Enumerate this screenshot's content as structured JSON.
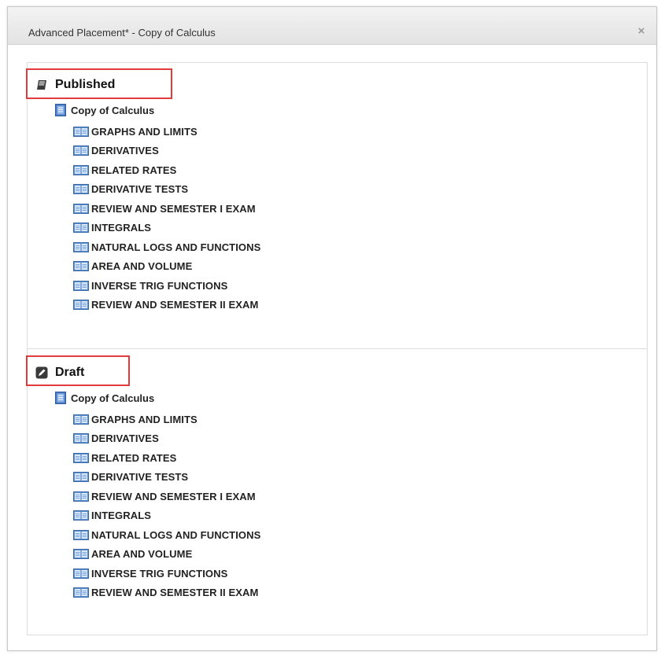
{
  "dialog": {
    "title": "Advanced Placement* - Copy of Calculus",
    "close_label": "×"
  },
  "colors": {
    "highlight": "#e23b3b",
    "unit_icon": "#5b8dcf",
    "course_icon": "#4a78c2"
  },
  "sections": {
    "published": {
      "heading": "Published",
      "heading_icon": "published-icon",
      "course": "Copy of Calculus",
      "units": [
        "GRAPHS AND LIMITS",
        "DERIVATIVES",
        "RELATED RATES",
        "DERIVATIVE TESTS",
        "REVIEW AND SEMESTER I EXAM",
        "INTEGRALS",
        "NATURAL LOGS AND FUNCTIONS",
        "AREA AND VOLUME",
        "INVERSE TRIG FUNCTIONS",
        "REVIEW AND SEMESTER II EXAM"
      ]
    },
    "draft": {
      "heading": "Draft",
      "heading_icon": "draft-edit-icon",
      "course": "Copy of Calculus",
      "units": [
        "GRAPHS AND LIMITS",
        "DERIVATIVES",
        "RELATED RATES",
        "DERIVATIVE TESTS",
        "REVIEW AND SEMESTER I EXAM",
        "INTEGRALS",
        "NATURAL LOGS AND FUNCTIONS",
        "AREA AND VOLUME",
        "INVERSE TRIG FUNCTIONS",
        "REVIEW AND SEMESTER II EXAM"
      ]
    }
  }
}
